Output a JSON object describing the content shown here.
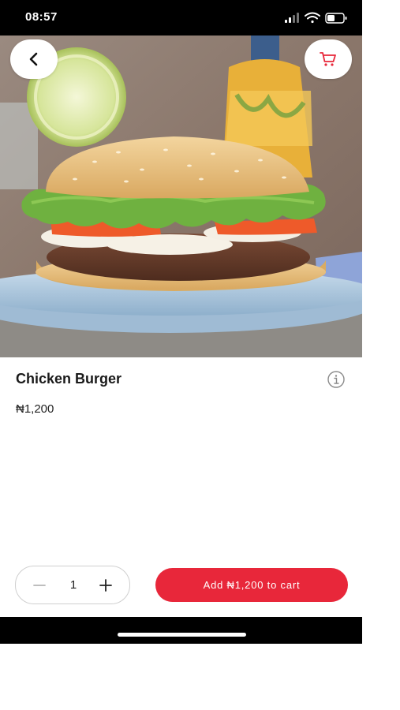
{
  "status_bar": {
    "time": "08:57"
  },
  "header": {
    "back_icon": "chevron-left-icon",
    "cart_icon": "shopping-cart-icon"
  },
  "product": {
    "name": "Chicken Burger",
    "price": "₦1,200",
    "info_icon": "info-icon"
  },
  "quantity": {
    "value": "1",
    "minus_icon": "minus-icon",
    "plus_icon": "plus-icon"
  },
  "add_to_cart": {
    "label": "Add ₦1,200 to cart"
  },
  "colors": {
    "accent": "#e8273a",
    "status_bar_bg": "#000000",
    "text": "#1a1a1a"
  }
}
